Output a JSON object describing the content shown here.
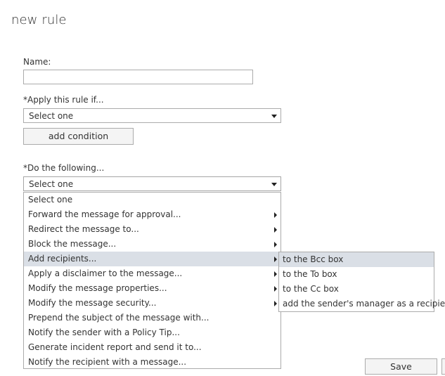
{
  "page": {
    "title": "new rule"
  },
  "form": {
    "name_label": "Name:",
    "name_value": "",
    "apply_label": "*Apply this rule if...",
    "apply_select_value": "Select one",
    "add_condition_label": "add condition",
    "do_label": "*Do the following...",
    "do_select_value": "Select one"
  },
  "dropdown": {
    "items": [
      {
        "label": "Select one",
        "has_submenu": false
      },
      {
        "label": "Forward the message for approval...",
        "has_submenu": true
      },
      {
        "label": "Redirect the message to...",
        "has_submenu": true
      },
      {
        "label": "Block the message...",
        "has_submenu": true
      },
      {
        "label": "Add recipients...",
        "has_submenu": true,
        "highlighted": true
      },
      {
        "label": "Apply a disclaimer to the message...",
        "has_submenu": true
      },
      {
        "label": "Modify the message properties...",
        "has_submenu": true
      },
      {
        "label": "Modify the message security...",
        "has_submenu": true
      },
      {
        "label": "Prepend the subject of the message with...",
        "has_submenu": false
      },
      {
        "label": "Notify the sender with a Policy Tip...",
        "has_submenu": false
      },
      {
        "label": "Generate incident report and send it to...",
        "has_submenu": false
      },
      {
        "label": "Notify the recipient with a message...",
        "has_submenu": false
      }
    ]
  },
  "submenu": {
    "items": [
      {
        "label": "to the Bcc box",
        "highlighted": true
      },
      {
        "label": "to the To box"
      },
      {
        "label": "to the Cc box"
      },
      {
        "label": "add the sender's manager as a recipient"
      }
    ]
  },
  "footer": {
    "save_label": "Save"
  },
  "colors": {
    "highlight": "#dadfe6",
    "border": "#ababab",
    "button_bg": "#f4f4f4"
  }
}
